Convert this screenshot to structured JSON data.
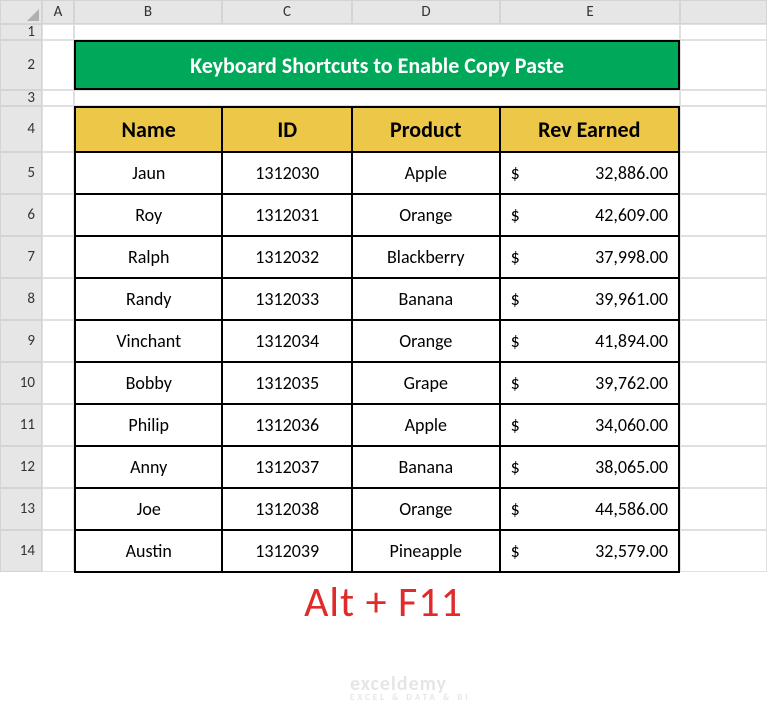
{
  "columns": [
    "A",
    "B",
    "C",
    "D",
    "E"
  ],
  "title": "Keyboard Shortcuts to Enable Copy Paste",
  "headers": {
    "name": "Name",
    "id": "ID",
    "product": "Product",
    "rev": "Rev Earned"
  },
  "rows": [
    {
      "name": "Jaun",
      "id": "1312030",
      "product": "Apple",
      "rev": "32,886.00"
    },
    {
      "name": "Roy",
      "id": "1312031",
      "product": "Orange",
      "rev": "42,609.00"
    },
    {
      "name": "Ralph",
      "id": "1312032",
      "product": "Blackberry",
      "rev": "37,998.00"
    },
    {
      "name": "Randy",
      "id": "1312033",
      "product": "Banana",
      "rev": "39,961.00"
    },
    {
      "name": "Vinchant",
      "id": "1312034",
      "product": "Orange",
      "rev": "41,894.00"
    },
    {
      "name": "Bobby",
      "id": "1312035",
      "product": "Grape",
      "rev": "39,762.00"
    },
    {
      "name": "Philip",
      "id": "1312036",
      "product": "Apple",
      "rev": "34,060.00"
    },
    {
      "name": "Anny",
      "id": "1312037",
      "product": "Banana",
      "rev": "38,065.00"
    },
    {
      "name": "Joe",
      "id": "1312038",
      "product": "Orange",
      "rev": "44,586.00"
    },
    {
      "name": "Austin",
      "id": "1312039",
      "product": "Pineapple",
      "rev": "32,579.00"
    }
  ],
  "shortcut_text": "Alt + F11",
  "watermark": "exceldemy",
  "watermark_sub": "EXCEL & DATA & BI",
  "currency": "$",
  "row_numbers": [
    "1",
    "2",
    "3",
    "4",
    "5",
    "6",
    "7",
    "8",
    "9",
    "10",
    "11",
    "12",
    "13",
    "14"
  ]
}
